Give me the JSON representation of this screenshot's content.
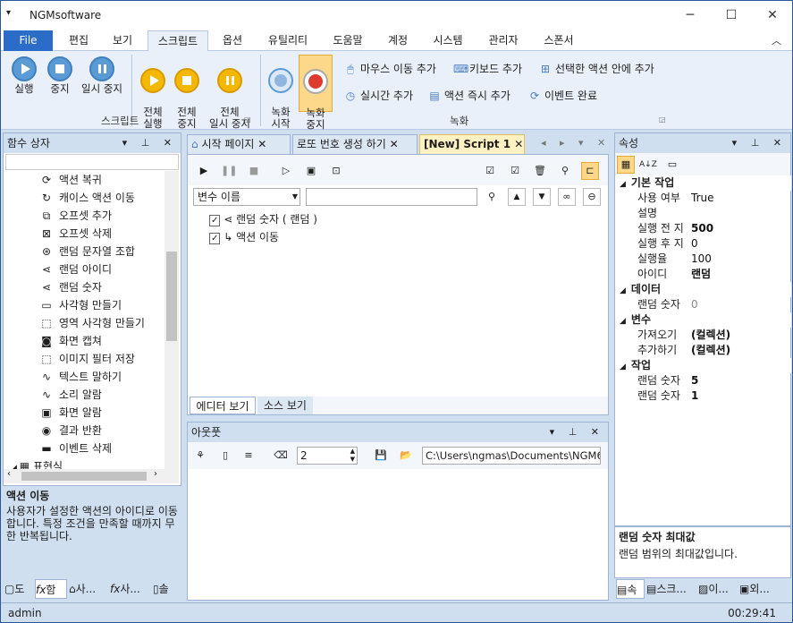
{
  "app": {
    "title": "NGMsoftware",
    "sysmenu": "▾",
    "min": "─",
    "max": "☐",
    "close": "✕"
  },
  "menu": {
    "file": "File",
    "tabs": [
      "편집",
      "보기",
      "스크립트",
      "옵션",
      "유틸리티",
      "도움말",
      "계정",
      "시스템",
      "관리자",
      "스폰서"
    ],
    "collapse": "︿"
  },
  "ribbon": {
    "script_group": "스크립트",
    "record_group": "녹화",
    "run": "실행",
    "stop": "중지",
    "pause": "일시 중지",
    "run_all": "전체\n실행",
    "stop_all": "전체\n중지",
    "pause_all": "전체\n일시 중지",
    "rec_start": "녹화\n시작",
    "rec_stop": "녹화\n중지",
    "mouse_add": "마우스 이동 추가",
    "kbd_add": "키보드 추가",
    "in_action_add": "선택한 액션 안에 추가",
    "realtime_add": "실시간 추가",
    "instant_add": "액션 즉시 추가",
    "event_done": "이벤트 완료"
  },
  "left_panel": {
    "title": "함수 상자",
    "search": "",
    "items": [
      {
        "label": "액션 복귀",
        "icon": "refresh-icon"
      },
      {
        "label": "캐이스 액션 이동",
        "icon": "loop-icon"
      },
      {
        "label": "오프셋 추가",
        "icon": "offset-add-icon"
      },
      {
        "label": "오프셋 삭제",
        "icon": "offset-delete-icon"
      },
      {
        "label": "랜덤 문자열 조합",
        "icon": "random-string-icon"
      },
      {
        "label": "랜덤 아이디",
        "icon": "share-icon"
      },
      {
        "label": "랜덤 숫자",
        "icon": "share-icon"
      },
      {
        "label": "사각형 만들기",
        "icon": "rectangle-icon"
      },
      {
        "label": "영역 사각형 만들기",
        "icon": "region-icon"
      },
      {
        "label": "화면 캡쳐",
        "icon": "camera-icon"
      },
      {
        "label": "이미지 필터 저장",
        "icon": "image-filter-icon"
      },
      {
        "label": "텍스트 말하기",
        "icon": "wave-icon"
      },
      {
        "label": "소리 알람",
        "icon": "wave-icon"
      },
      {
        "label": "화면 알람",
        "icon": "screen-icon"
      },
      {
        "label": "결과 반환",
        "icon": "target-icon"
      },
      {
        "label": "이벤트 삭제",
        "icon": "delete-icon"
      }
    ],
    "partial": "표현식",
    "desc_title": "액션 이동",
    "desc_text": "사용자가 설정한 액션의 아이디로 이동합니다. 특정 조건을 만족할 때까지 무한 반복됩니다.",
    "bottom_tabs": [
      "도",
      "함",
      "사...",
      "사...",
      "솔"
    ]
  },
  "doc_tabs": {
    "tabs": [
      "시작 페이지",
      "로또 번호 생성 하기",
      "[New] Script 1"
    ]
  },
  "editor": {
    "var_select": "변수 이름",
    "search": "",
    "rows": [
      {
        "label": "랜덤 숫자 ( 랜덤 )"
      },
      {
        "label": "액션 이동"
      }
    ],
    "view_tabs": [
      "에디터 보기",
      "소스 보기"
    ]
  },
  "output": {
    "title": "아웃풋",
    "count": "2",
    "path": "C:\\Users\\ngmas\\Documents\\NGM6\\"
  },
  "props": {
    "title": "속성",
    "cats": [
      "기본 작업",
      "데이터",
      "변수",
      "작업"
    ],
    "basic": [
      [
        "사용 여부",
        "True"
      ],
      [
        "설명",
        ""
      ],
      [
        "실행 전 지",
        "500"
      ],
      [
        "실행 후 지",
        "0"
      ],
      [
        "실행율",
        "100"
      ],
      [
        "아이디",
        "랜덤"
      ]
    ],
    "data": [
      [
        "랜덤 숫자",
        "0"
      ]
    ],
    "vars": [
      [
        "가져오기",
        "(컬렉션)"
      ],
      [
        "추가하기",
        "(컬렉션)"
      ]
    ],
    "work": [
      [
        "랜덤 숫자",
        "5"
      ],
      [
        "랜덤 숫자",
        "1"
      ]
    ],
    "desc_title": "랜덤 숫자 최대값",
    "desc_text": "랜덤 범위의 최대값입니다.",
    "bottom_tabs": [
      "속",
      "스크...",
      "이...",
      "외..."
    ]
  },
  "status": {
    "user": "admin",
    "time": "00:29:41"
  },
  "colors": {
    "accent": "#2b6cc9",
    "play_blue": "#5b9bd5",
    "play_yellow": "#f5b800",
    "rec_red": "#e03a2f"
  }
}
